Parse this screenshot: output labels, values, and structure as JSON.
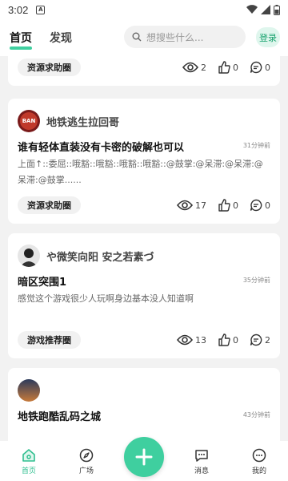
{
  "status_bar": {
    "time": "3:02",
    "notif_glyph": "A"
  },
  "top_nav": {
    "tabs": [
      {
        "label": "首页",
        "active": true
      },
      {
        "label": "发现",
        "active": false
      }
    ],
    "search_placeholder": "想搜些什么...",
    "login_label": "登录"
  },
  "posts": [
    {
      "tag": "资源求助圈",
      "views": "2",
      "likes": "0",
      "comments": "0"
    },
    {
      "author": "地铁逃生拉回哥",
      "avatar_text": "BAN",
      "title": "谁有轻体直装没有卡密的破解也可以",
      "time": "31分钟前",
      "body": "上面↑::委屈::哦豁::哦豁::哦豁::哦豁::@鼓掌:@呆滞:@呆滞:@呆滞:@鼓掌......",
      "tag": "资源求助圈",
      "views": "17",
      "likes": "0",
      "comments": "0"
    },
    {
      "author": "や微笑向阳 安之若素づ",
      "title": "暗区突围1",
      "time": "35分钟前",
      "body": "感觉这个游戏很少人玩啊身边基本没人知道啊",
      "tag": "游戏推荐圈",
      "views": "13",
      "likes": "0",
      "comments": "2"
    },
    {
      "author": "",
      "title": "地铁跑酷乱码之城",
      "time": "43分钟前"
    }
  ],
  "bottom_nav": [
    {
      "label": "首页",
      "icon": "home-icon",
      "active": true
    },
    {
      "label": "广场",
      "icon": "compass-icon",
      "active": false
    },
    {
      "label": "消息",
      "icon": "message-icon",
      "active": false
    },
    {
      "label": "我的",
      "icon": "profile-icon",
      "active": false
    }
  ],
  "colors": {
    "accent": "#3fcf9f",
    "background": "#f2f2f2"
  }
}
